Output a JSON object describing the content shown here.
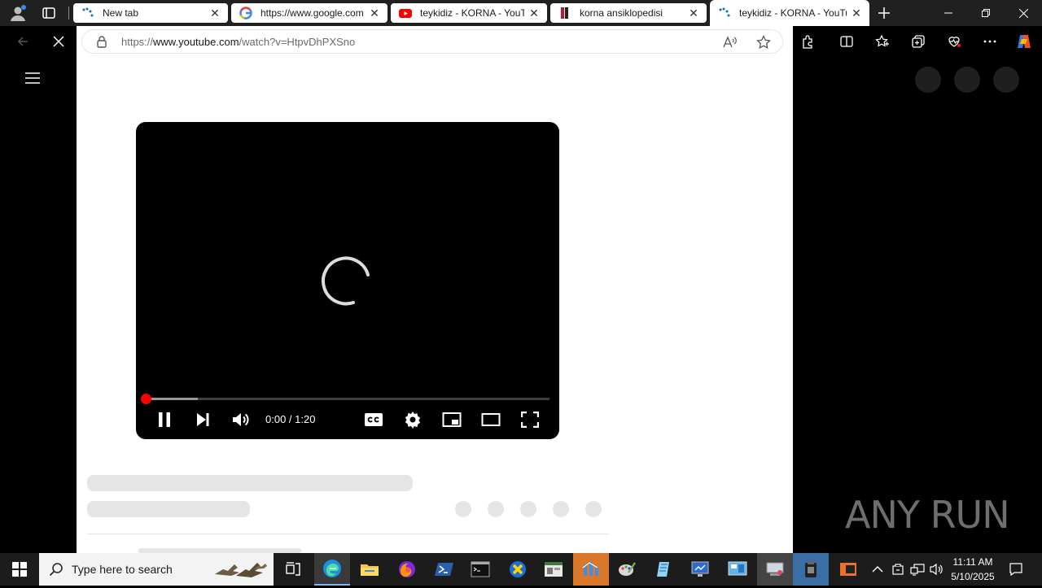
{
  "tabs": [
    {
      "title": "New tab",
      "favicon": "edge-loading-icon",
      "state": "inactive"
    },
    {
      "title": "https://www.google.com",
      "favicon": "google-icon",
      "state": "inactive"
    },
    {
      "title": "teykidiz - KORNA - YouTube",
      "favicon": "youtube-icon",
      "state": "inactive"
    },
    {
      "title": "korna ansiklopedisi",
      "favicon": "bookmark-icon",
      "state": "inactive"
    },
    {
      "title": "teykidiz - KORNA - YouTube",
      "favicon": "edge-loading-icon",
      "state": "active"
    }
  ],
  "address_bar": {
    "url_prefix": "https://",
    "url_host": "www.youtube.com",
    "url_path": "/watch?v=HtpvDhPXSno"
  },
  "player": {
    "time_display": "0:00 / 1:20",
    "progress_played": 0,
    "progress_buffered": 0.13,
    "state": "loading"
  },
  "taskbar": {
    "search_placeholder": "Type here to search",
    "clock_time": "11:11 AM",
    "clock_date": "5/10/2025"
  },
  "watermark": "ANY RUN",
  "colors": {
    "accent_red": "#ff0000",
    "taskbar_bg": "#1c1c1c",
    "titlebar_bg": "#202020",
    "skeleton": "#e5e5e5"
  }
}
